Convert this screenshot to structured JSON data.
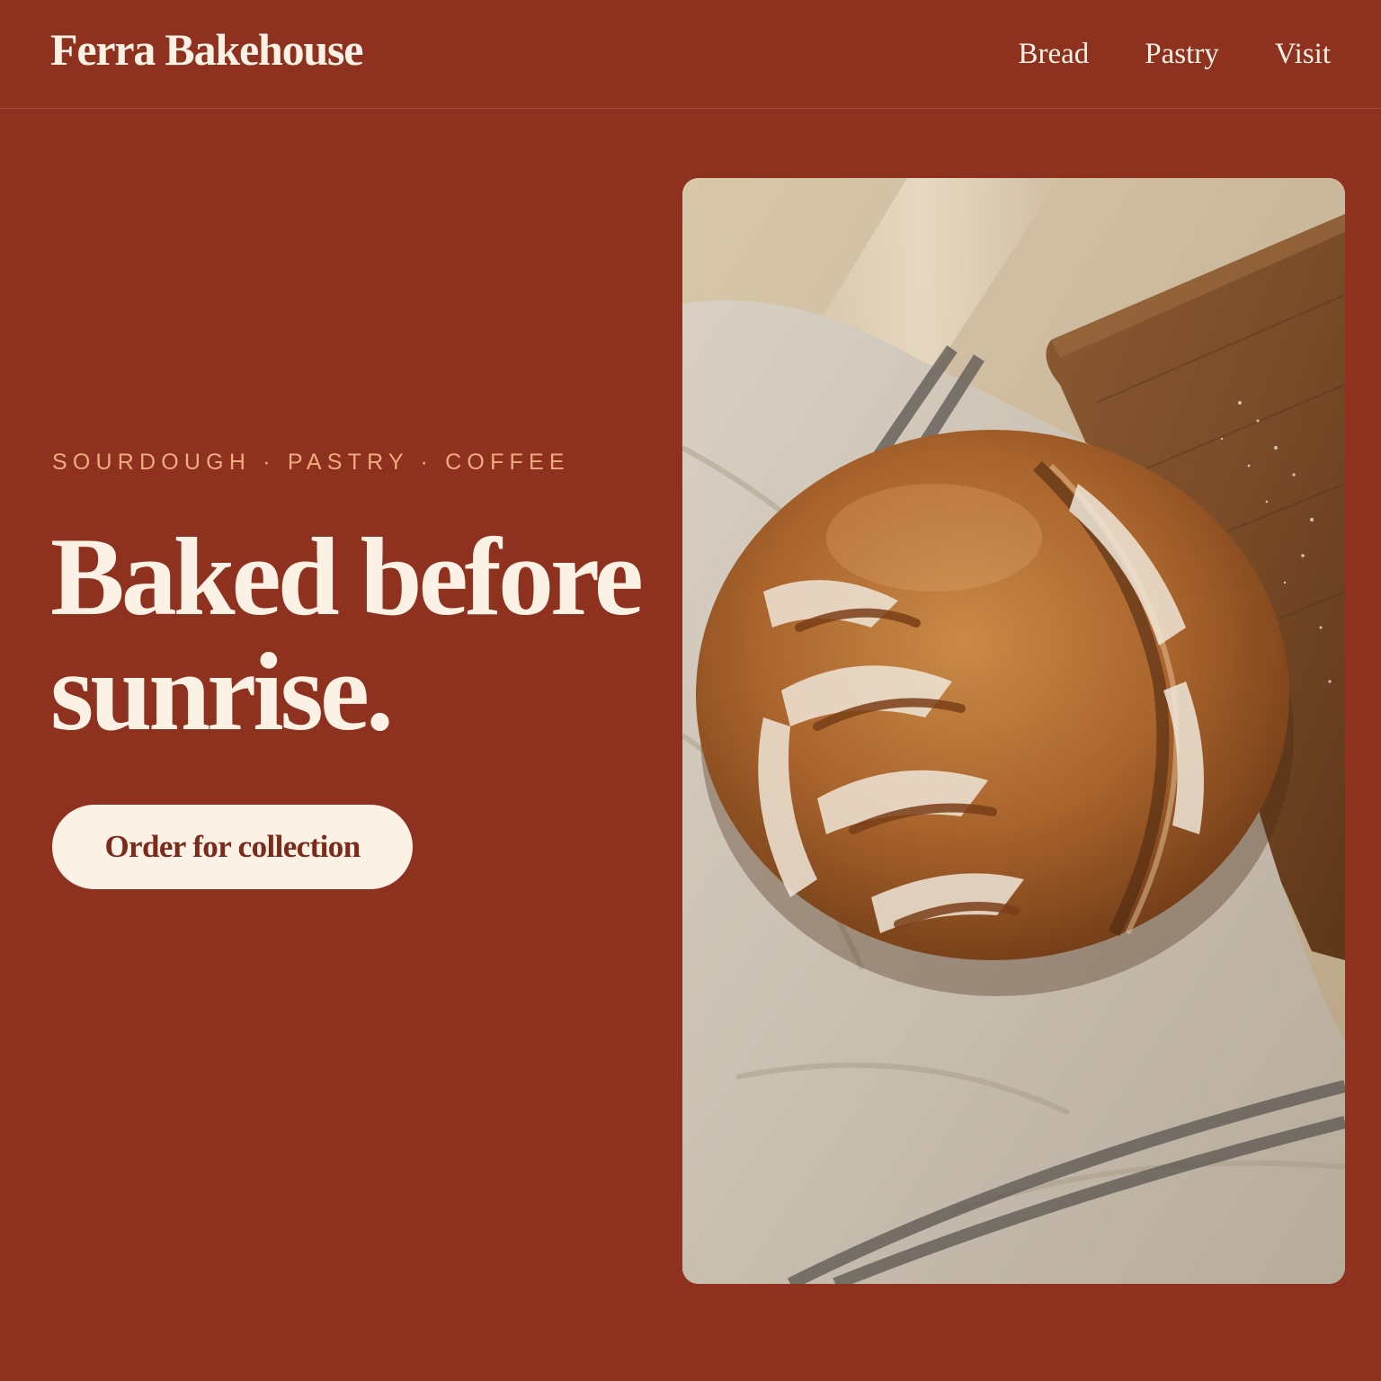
{
  "header": {
    "brand": "Ferra Bakehouse",
    "nav": [
      {
        "label": "Bread"
      },
      {
        "label": "Pastry"
      },
      {
        "label": "Visit"
      }
    ]
  },
  "hero": {
    "eyebrow": "SOURDOUGH · PASTRY · COFFEE",
    "headline": "Baked before sunrise.",
    "cta_label": "Order for collection"
  },
  "photo": {
    "subject": "sourdough-loaf-on-linen-cloth"
  },
  "colors": {
    "background": "#8f311f",
    "cream": "#fbf1e4",
    "eyebrow": "#f0ab7f",
    "cta_text": "#7c2a1b"
  }
}
